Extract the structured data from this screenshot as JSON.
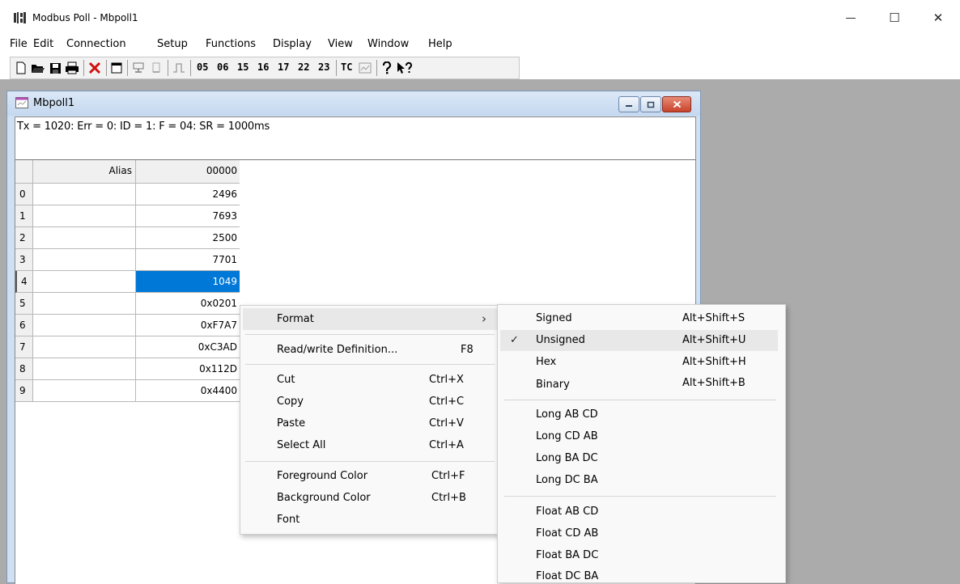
{
  "window": {
    "title": "Modbus Poll - Mbpoll1",
    "minimize_glyph": "—",
    "maximize_glyph": "☐",
    "close_glyph": "✕"
  },
  "menu": [
    "File",
    "Edit",
    "Connection",
    "Setup",
    "Functions",
    "Display",
    "View",
    "Window",
    "Help"
  ],
  "toolbar": {
    "function_codes": [
      "05",
      "06",
      "15",
      "16",
      "17",
      "22",
      "23"
    ],
    "tc_label": "TC"
  },
  "child": {
    "title": "Mbpoll1",
    "status": "Tx = 1020: Err = 0: ID = 1: F = 04: SR = 1000ms"
  },
  "grid": {
    "alias_header": "Alias",
    "col_header": "00000",
    "rows": [
      {
        "n": "0",
        "v": "2496"
      },
      {
        "n": "1",
        "v": "7693"
      },
      {
        "n": "2",
        "v": "2500"
      },
      {
        "n": "3",
        "v": "7701"
      },
      {
        "n": "4",
        "v": "1049"
      },
      {
        "n": "5",
        "v": "0x0201"
      },
      {
        "n": "6",
        "v": "0xF7A7"
      },
      {
        "n": "7",
        "v": "0xC3AD"
      },
      {
        "n": "8",
        "v": "0x112D"
      },
      {
        "n": "9",
        "v": "0x4400"
      }
    ],
    "selected_row": "4"
  },
  "context_menu": {
    "format": "Format",
    "format_arrow": "›",
    "rw_def": "Read/write Definition...",
    "rw_def_sc": "F8",
    "cut": "Cut",
    "cut_sc": "Ctrl+X",
    "copy": "Copy",
    "copy_sc": "Ctrl+C",
    "paste": "Paste",
    "paste_sc": "Ctrl+V",
    "select_all": "Select All",
    "select_all_sc": "Ctrl+A",
    "fg": "Foreground Color",
    "fg_sc": "Ctrl+F",
    "bg": "Background Color",
    "bg_sc": "Ctrl+B",
    "font": "Font"
  },
  "submenu": {
    "signed": "Signed",
    "signed_sc": "Alt+Shift+S",
    "unsigned": "Unsigned",
    "unsigned_sc": "Alt+Shift+U",
    "check": "✓",
    "hex": "Hex",
    "hex_sc": "Alt+Shift+H",
    "binary": "Binary",
    "binary_sc": "Alt+Shift+B",
    "long_ab_cd": "Long AB CD",
    "long_cd_ab": "Long CD AB",
    "long_ba_dc": "Long BA DC",
    "long_dc_ba": "Long DC BA",
    "float_ab_cd": "Float AB CD",
    "float_cd_ab": "Float CD AB",
    "float_ba_dc": "Float BA DC",
    "float_dc_ba": "Float DC BA"
  },
  "colors": {
    "selection": "#0078d7",
    "child_close": "#c9432c",
    "mdi_background": "#ababab"
  }
}
